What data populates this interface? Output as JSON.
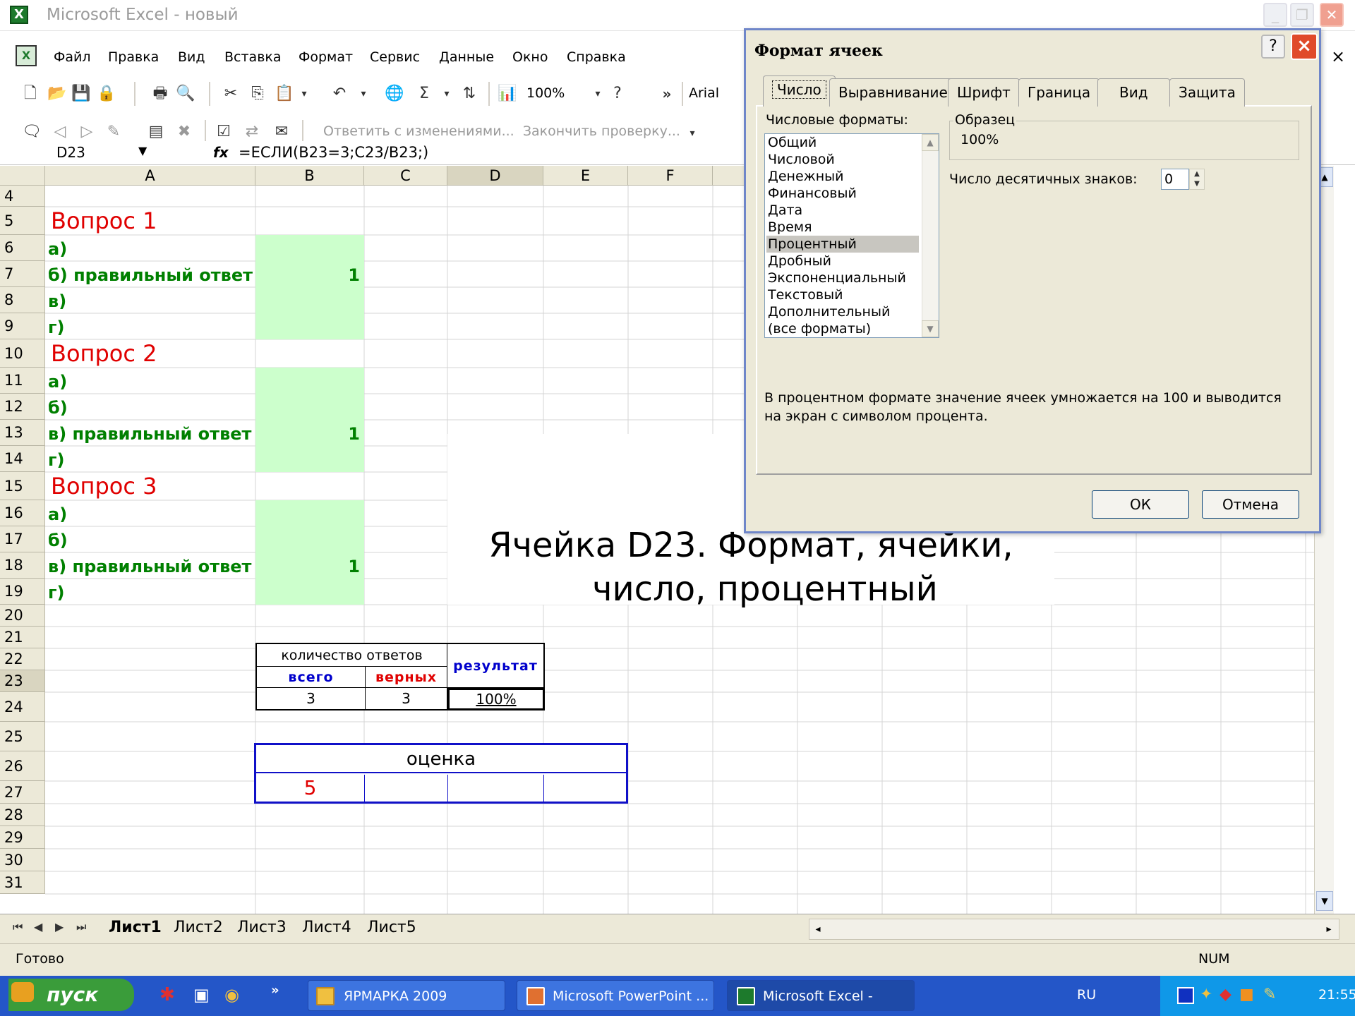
{
  "window": {
    "title": "Microsoft Excel - новый",
    "app_icon": "X"
  },
  "menu": {
    "items": [
      "Файл",
      "Правка",
      "Вид",
      "Вставка",
      "Формат",
      "Сервис",
      "Данные",
      "Окно",
      "Справка"
    ],
    "close_glyph": "×"
  },
  "toolbar": {
    "zoom": "100%",
    "font": "Arial",
    "track_reply": "Ответить с изменениями...",
    "end_review": "Закончить проверку...",
    "chevron": "»"
  },
  "formula_bar": {
    "name_box": "D23",
    "fx": "fx",
    "formula": "=ЕСЛИ(B23=3;C23/B23;)"
  },
  "grid": {
    "columns": [
      "A",
      "B",
      "C",
      "D",
      "E",
      "F"
    ],
    "rows": [
      "4",
      "5",
      "6",
      "7",
      "8",
      "9",
      "10",
      "11",
      "12",
      "13",
      "14",
      "15",
      "16",
      "17",
      "18",
      "19",
      "20",
      "21",
      "22",
      "23",
      "24",
      "25",
      "26",
      "27",
      "28",
      "29",
      "30",
      "31"
    ],
    "q1": "Вопрос 1",
    "q2": "Вопрос 2",
    "q3": "Вопрос 3",
    "a": "а)",
    "b": "б)",
    "b_correct": "б) правильный ответ",
    "v": "в)",
    "v_correct": "в) правильный ответ",
    "g": "г)",
    "one": "1",
    "answers_count": "количество ответов",
    "total": "всего",
    "correct": "верных",
    "result": "результат",
    "total_val": "3",
    "correct_val": "3",
    "result_val": "100%",
    "grade_label": "оценка",
    "grade_val": "5",
    "note_line1": "Ячейка D23. Формат, ячейки,",
    "note_line2": "число, процентный"
  },
  "sheets": {
    "tabs": [
      "Лист1",
      "Лист2",
      "Лист3",
      "Лист4",
      "Лист5"
    ],
    "active": "Лист1"
  },
  "status": {
    "ready": "Готово",
    "num": "NUM"
  },
  "taskbar": {
    "start": "пуск",
    "tasks": [
      "ЯРМАРКА 2009",
      "Microsoft PowerPoint ...",
      "Microsoft Excel - новый"
    ],
    "lang": "RU",
    "clock": "21:55"
  },
  "dialog": {
    "title": "Формат ячеек",
    "help": "?",
    "close": "×",
    "tabs": [
      "Число",
      "Выравнивание",
      "Шрифт",
      "Граница",
      "Вид",
      "Защита"
    ],
    "formats_label": "Числовые форматы:",
    "formats": [
      "Общий",
      "Числовой",
      "Денежный",
      "Финансовый",
      "Дата",
      "Время",
      "Процентный",
      "Дробный",
      "Экспоненциальный",
      "Текстовый",
      "Дополнительный",
      "(все форматы)"
    ],
    "selected_format": "Процентный",
    "sample_label": "Образец",
    "sample_value": "100%",
    "decimals_label": "Число десятичных знаков:",
    "decimals_value": "0",
    "description": "В процентном формате значение ячеек умножается на 100 и выводится на экран с символом процента.",
    "ok": "ОК",
    "cancel": "Отмена"
  },
  "colors": {
    "accent_green": "#ccffcc",
    "question_red": "#e00000",
    "answer_green": "#008000",
    "grade_blue": "#0000cc"
  }
}
